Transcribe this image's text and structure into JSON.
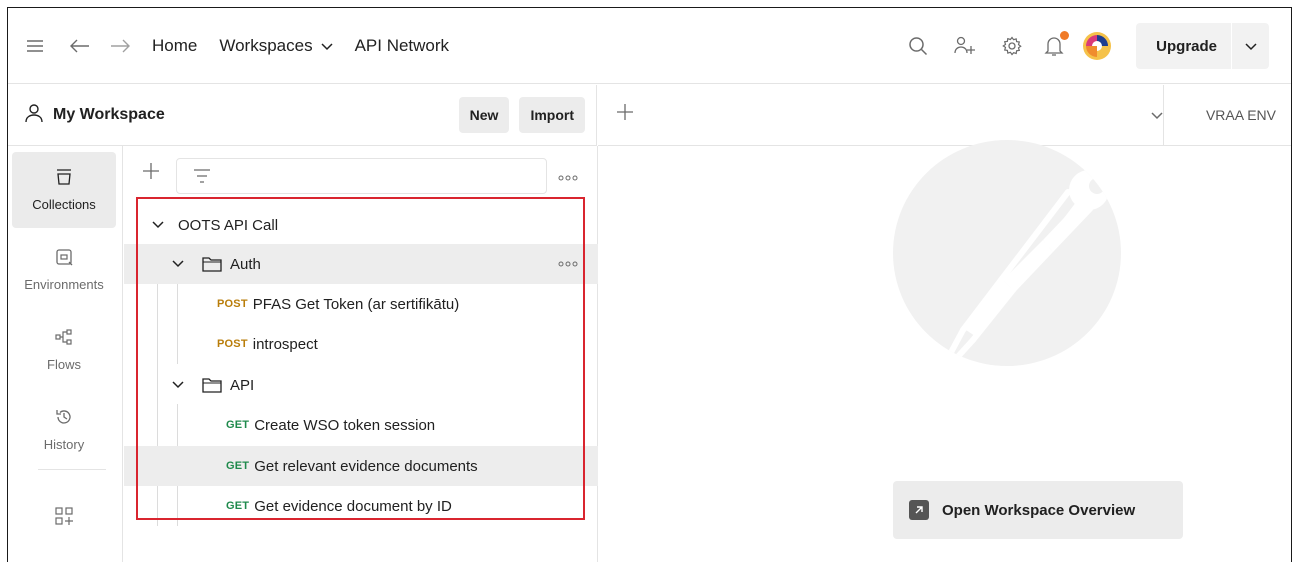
{
  "topbar": {
    "nav": [
      "Home",
      "Workspaces",
      "API Network"
    ],
    "upgrade_label": "Upgrade"
  },
  "workspace": {
    "title": "My Workspace",
    "new_label": "New",
    "import_label": "Import"
  },
  "tabs": {
    "environment": "VRAA ENV"
  },
  "rail": {
    "items": [
      {
        "label": "Collections",
        "icon": "collections-icon"
      },
      {
        "label": "Environments",
        "icon": "environments-icon"
      },
      {
        "label": "Flows",
        "icon": "flows-icon"
      },
      {
        "label": "History",
        "icon": "history-icon"
      }
    ]
  },
  "collection": {
    "name": "OOTS API Call",
    "folders": [
      {
        "name": "Auth",
        "requests": [
          {
            "method": "POST",
            "name": "PFAS Get Token (ar sertifikātu)"
          },
          {
            "method": "POST",
            "name": "introspect"
          }
        ]
      },
      {
        "name": "API",
        "requests": [
          {
            "method": "GET",
            "name": "Create WSO token session"
          },
          {
            "method": "GET",
            "name": "Get relevant evidence documents"
          },
          {
            "method": "GET",
            "name": "Get evidence document by ID"
          }
        ]
      }
    ]
  },
  "main": {
    "overview_label": "Open Workspace Overview"
  },
  "colors": {
    "post": "#b97d0a",
    "get": "#1f8a4c",
    "highlight_box": "#d9252f",
    "notification_dot": "#f07b28"
  }
}
